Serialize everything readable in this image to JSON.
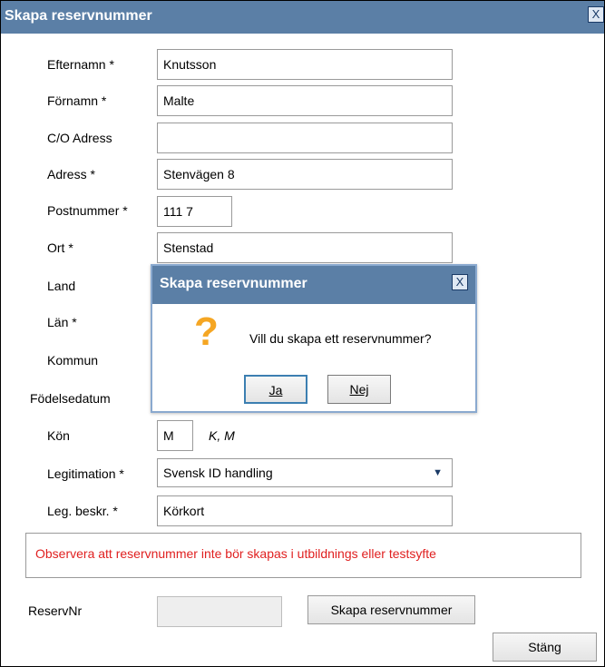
{
  "window": {
    "title": "Skapa reservnummer",
    "close_label": "X"
  },
  "form": {
    "efternamn": {
      "label": "Efternamn *",
      "value": "Knutsson"
    },
    "fornamn": {
      "label": "Förnamn *",
      "value": "Malte"
    },
    "co_adress": {
      "label": "C/O Adress",
      "value": ""
    },
    "adress": {
      "label": "Adress *",
      "value": "Stenvägen 8"
    },
    "postnummer": {
      "label": "Postnummer *",
      "value": "111 7"
    },
    "ort": {
      "label": "Ort *",
      "value": "Stenstad"
    },
    "land": {
      "label": "Land"
    },
    "lan": {
      "label": "Län *"
    },
    "kommun": {
      "label": "Kommun"
    },
    "fodelsedatum": {
      "label": "Födelsedatum"
    },
    "kon": {
      "label": "Kön",
      "value": "M",
      "hint": "K, M"
    },
    "legitimation": {
      "label": "Legitimation *",
      "selected": "Svensk ID handling"
    },
    "leg_beskr": {
      "label": "Leg. beskr. *",
      "value": "Körkort"
    }
  },
  "warning": {
    "text": "Observera att reservnummer inte bör skapas i utbildnings eller testsyfte"
  },
  "reserv": {
    "label": "ReservNr",
    "value": "",
    "button_label": "Skapa reservnummer"
  },
  "footer": {
    "close_button_label": "Stäng"
  },
  "dialog": {
    "title": "Skapa reservnummer",
    "close_label": "X",
    "icon": "question-icon",
    "message": "Vill du skapa ett reservnummer?",
    "yes_label": "Ja",
    "no_label": "Nej"
  },
  "colors": {
    "titlebar": "#5b7fa6",
    "warning_text": "#e02020",
    "question_icon": "#f5a623"
  }
}
